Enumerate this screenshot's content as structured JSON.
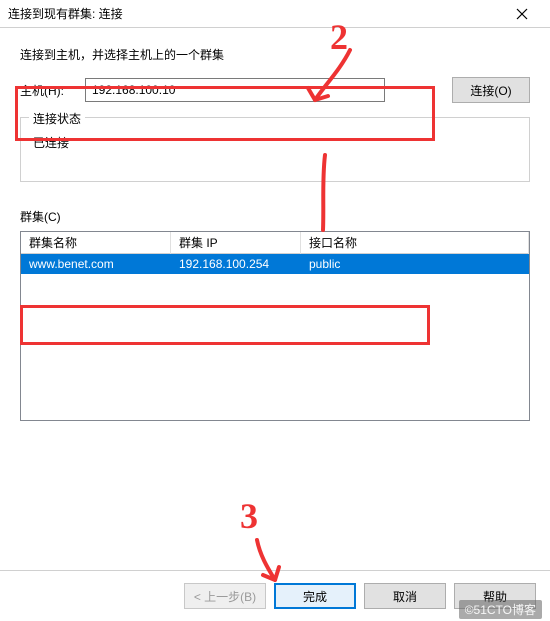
{
  "titlebar": {
    "title": "连接到现有群集: 连接"
  },
  "instruction": "连接到主机，并选择主机上的一个群集",
  "host": {
    "label": "主机(H):",
    "value": "192.168.100.10"
  },
  "buttons": {
    "connect": "连接(O)",
    "back": "< 上一步(B)",
    "finish": "完成",
    "cancel": "取消",
    "help": "帮助"
  },
  "status": {
    "legend": "连接状态",
    "text": "已连接"
  },
  "cluster": {
    "label": "群集(C)",
    "headers": {
      "name": "群集名称",
      "ip": "群集 IP",
      "iface": "接口名称"
    },
    "rows": [
      {
        "name": "www.benet.com",
        "ip": "192.168.100.254",
        "iface": "public"
      }
    ]
  },
  "watermark": "©51CTO博客",
  "annotations": {
    "n2": "2",
    "n3": "3"
  }
}
